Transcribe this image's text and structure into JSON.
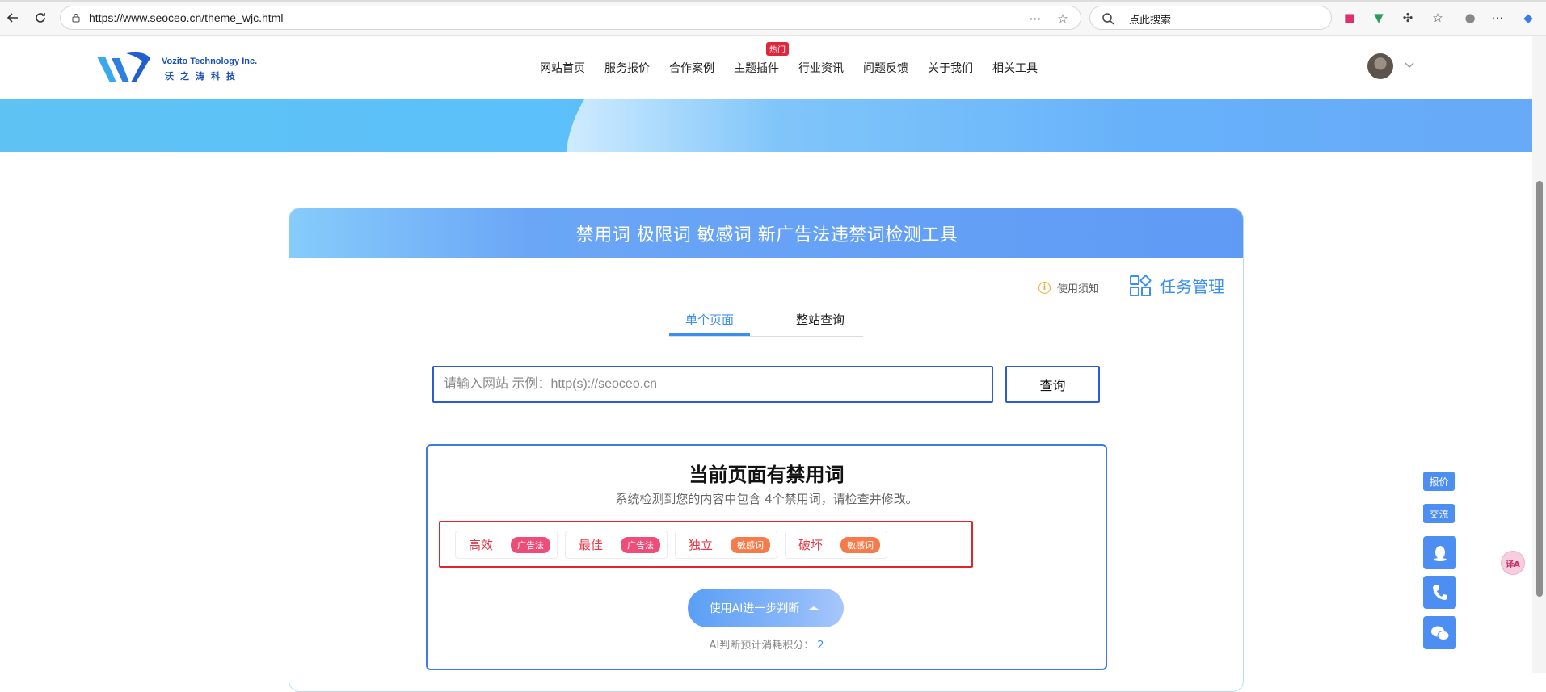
{
  "browser": {
    "url": "https://www.seoceo.cn/theme_wjc.html",
    "search_placeholder": "点此搜索"
  },
  "site": {
    "logo_en": "Vozito Technology Inc.",
    "logo_cn": "沃之涛科技",
    "nav": [
      "网站首页",
      "服务报价",
      "合作案例",
      "主题插件",
      "行业资讯",
      "问题反馈",
      "关于我们",
      "相关工具"
    ],
    "hot_badge": "热门"
  },
  "tool": {
    "title": "禁用词 极限词 敏感词 新广告法违禁词检测工具",
    "notice": "使用须知",
    "task": "任务管理",
    "tabs": [
      "单个页面",
      "整站查询"
    ],
    "input_placeholder": "请输入网站 示例：http(s)://seoceo.cn",
    "query_button": "查询",
    "result": {
      "title": "当前页面有禁用词",
      "desc": "系统检测到您的内容中包含 4个禁用词，请检查并修改。",
      "words": [
        {
          "word": "高效",
          "tag": "广告法",
          "tag_color": "#ee4d79"
        },
        {
          "word": "最佳",
          "tag": "广告法",
          "tag_color": "#ee4d79"
        },
        {
          "word": "独立",
          "tag": "敏感词",
          "tag_color": "#f57c4a"
        },
        {
          "word": "破坏",
          "tag": "敏感词",
          "tag_color": "#f57c4a"
        }
      ],
      "ai_button": "使用AI进一步判断",
      "cost_label": "AI判断预计消耗积分：",
      "cost_value": "2"
    }
  },
  "side": {
    "price": "报价",
    "chat": "交流"
  }
}
